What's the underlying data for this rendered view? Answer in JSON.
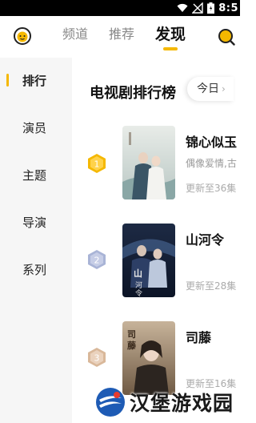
{
  "status_bar": {
    "time": "8:5"
  },
  "header": {
    "tabs": [
      {
        "label": "频道",
        "active": false
      },
      {
        "label": "推荐",
        "active": false
      },
      {
        "label": "发现",
        "active": true
      }
    ],
    "accent_color": "#f5b800"
  },
  "sidebar": {
    "items": [
      {
        "label": "排行",
        "active": true
      },
      {
        "label": "演员",
        "active": false
      },
      {
        "label": "主题",
        "active": false
      },
      {
        "label": "导演",
        "active": false
      },
      {
        "label": "系列",
        "active": false
      }
    ]
  },
  "ranking": {
    "title": "电视剧排行榜",
    "date_filter": "今日",
    "items": [
      {
        "rank": "1",
        "title": "锦心似玉",
        "tags": "偶像爱情,古",
        "update": "更新至36集",
        "medal_color": "#f5b800"
      },
      {
        "rank": "2",
        "title": "山河令",
        "tags": "",
        "update": "更新至28集",
        "medal_color": "#a9b4d6"
      },
      {
        "rank": "3",
        "title": "司藤",
        "tags": "",
        "update": "更新至16集",
        "medal_color": "#d9b89a"
      }
    ]
  },
  "watermark": {
    "text": "汉堡游戏园"
  }
}
